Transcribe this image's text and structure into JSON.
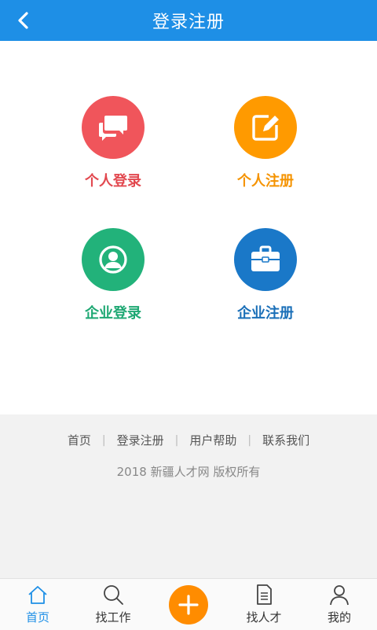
{
  "header": {
    "title": "登录注册"
  },
  "tiles": [
    {
      "label": "个人登录",
      "color": "#f0555b",
      "icon": "chat-bubbles-icon"
    },
    {
      "label": "个人注册",
      "color": "#ff9a00",
      "icon": "edit-note-icon"
    },
    {
      "label": "企业登录",
      "color": "#22b27a",
      "icon": "user-circle-icon"
    },
    {
      "label": "企业注册",
      "color": "#1a78c8",
      "icon": "briefcase-icon"
    }
  ],
  "footer": {
    "links": [
      "首页",
      "登录注册",
      "用户帮助",
      "联系我们"
    ],
    "copyright": "2018 新疆人才网 版权所有"
  },
  "tabbar": {
    "items": [
      {
        "label": "首页",
        "icon": "home-icon",
        "active": true
      },
      {
        "label": "找工作",
        "icon": "search-icon",
        "active": false
      },
      {
        "label": "",
        "icon": "plus-icon",
        "active": false
      },
      {
        "label": "找人才",
        "icon": "document-icon",
        "active": false
      },
      {
        "label": "我的",
        "icon": "user-icon",
        "active": false
      }
    ]
  },
  "colors": {
    "primary": "#1e8fe6",
    "accent": "#ff8c00"
  }
}
